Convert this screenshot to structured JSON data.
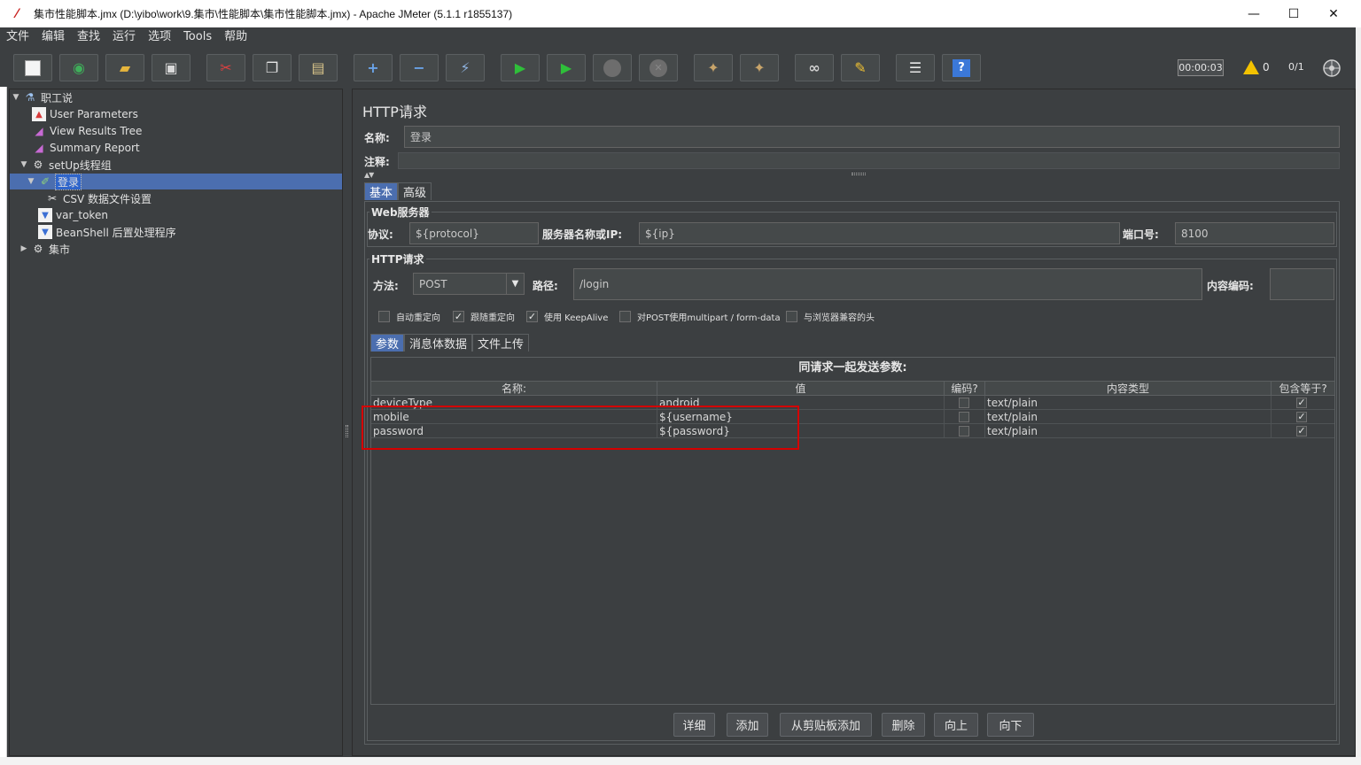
{
  "window": {
    "title": "集市性能脚本.jmx (D:\\yibo\\work\\9.集市\\性能脚本\\集市性能脚本.jmx) - Apache JMeter (5.1.1 r1855137)",
    "minimize": "—",
    "maximize": "☐",
    "close": "✕"
  },
  "menu": [
    "文件",
    "编辑",
    "查找",
    "运行",
    "选项",
    "Tools",
    "帮助"
  ],
  "status": {
    "timer": "00:00:03",
    "warnings": "0",
    "threads": "0/1"
  },
  "tree": [
    {
      "label": "职工说",
      "icon": "test-plan-icon",
      "level": 0,
      "toggle": "▼"
    },
    {
      "label": "User Parameters",
      "icon": "pre-processor-icon",
      "level": 1,
      "toggle": ""
    },
    {
      "label": "View Results Tree",
      "icon": "listener-icon",
      "level": 1,
      "toggle": ""
    },
    {
      "label": "Summary Report",
      "icon": "listener-icon",
      "level": 1,
      "toggle": ""
    },
    {
      "label": "setUp线程组",
      "icon": "thread-group-icon",
      "level": 1,
      "toggle": "▼"
    },
    {
      "label": "登录",
      "icon": "sampler-icon",
      "level": 2,
      "toggle": "▼",
      "selected": true
    },
    {
      "label": "CSV 数据文件设置",
      "icon": "config-element-icon",
      "level": 3,
      "toggle": ""
    },
    {
      "label": "var_token",
      "icon": "post-processor-icon",
      "level": 3,
      "toggle": ""
    },
    {
      "label": "BeanShell 后置处理程序",
      "icon": "post-processor-icon",
      "level": 3,
      "toggle": ""
    },
    {
      "label": "集市",
      "icon": "thread-group-icon",
      "level": 1,
      "toggle": "▶"
    }
  ],
  "panel": {
    "title": "HTTP请求",
    "name_label": "名称:",
    "name_value": "登录",
    "comment_label": "注释:",
    "comment_value": "",
    "tabs": [
      "基本",
      "高级"
    ],
    "web_server": {
      "title": "Web服务器",
      "protocol_label": "协议:",
      "protocol_value": "${protocol}",
      "server_label": "服务器名称或IP:",
      "server_value": "${ip}",
      "port_label": "端口号:",
      "port_value": "8100"
    },
    "http_request": {
      "title": "HTTP请求",
      "method_label": "方法:",
      "method_value": "POST",
      "path_label": "路径:",
      "path_value": "/login",
      "encoding_label": "内容编码:",
      "encoding_value": ""
    },
    "checkboxes": [
      {
        "label": "自动重定向",
        "checked": false
      },
      {
        "label": "跟随重定向",
        "checked": true
      },
      {
        "label": "使用 KeepAlive",
        "checked": true
      },
      {
        "label": "对POST使用multipart / form-data",
        "checked": false
      },
      {
        "label": "与浏览器兼容的头",
        "checked": false
      }
    ],
    "subtabs": [
      "参数",
      "消息体数据",
      "文件上传"
    ],
    "params": {
      "caption": "同请求一起发送参数:",
      "columns": [
        "名称:",
        "值",
        "编码?",
        "内容类型",
        "包含等于?"
      ],
      "rows": [
        {
          "name": "deviceType",
          "value": "android",
          "encode": false,
          "content_type": "text/plain",
          "include_equals": true
        },
        {
          "name": "mobile",
          "value": "${username}",
          "encode": false,
          "content_type": "text/plain",
          "include_equals": true
        },
        {
          "name": "password",
          "value": "${password}",
          "encode": false,
          "content_type": "text/plain",
          "include_equals": true
        }
      ]
    },
    "buttons": [
      "详细",
      "添加",
      "从剪贴板添加",
      "删除",
      "向上",
      "向下"
    ]
  },
  "colors": {
    "background": "#3c3f41",
    "selection": "#4b6eaf",
    "highlight_box": "#d40000"
  }
}
